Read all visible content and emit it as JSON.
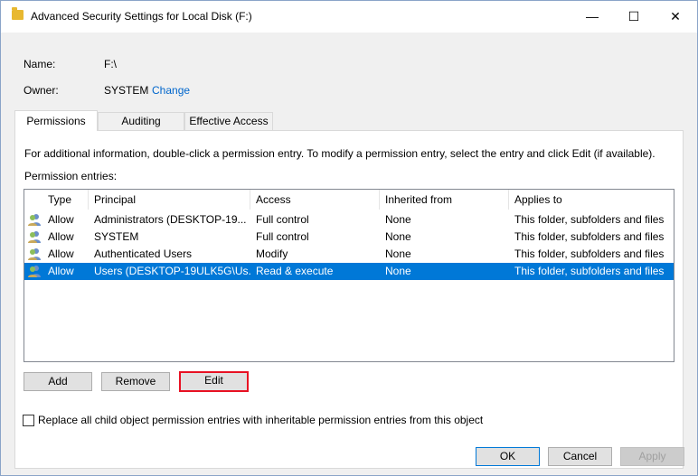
{
  "window": {
    "title": "Advanced Security Settings for Local Disk (F:)",
    "controls": {
      "minimize": "—",
      "maximize": "☐",
      "close": "✕"
    }
  },
  "info": {
    "name_label": "Name:",
    "name_value": "F:\\",
    "owner_label": "Owner:",
    "owner_value": "SYSTEM",
    "change_link": "Change"
  },
  "tabs": [
    {
      "label": "Permissions",
      "active": true
    },
    {
      "label": "Auditing",
      "active": false
    },
    {
      "label": "Effective Access",
      "active": false
    }
  ],
  "permissions": {
    "info_text": "For additional information, double-click a permission entry. To modify a permission entry, select the entry and click Edit (if available).",
    "entries_label": "Permission entries:",
    "columns": [
      "Type",
      "Principal",
      "Access",
      "Inherited from",
      "Applies to"
    ],
    "rows": [
      {
        "type": "Allow",
        "principal": "Administrators (DESKTOP-19...",
        "access": "Full control",
        "inherited": "None",
        "applies": "This folder, subfolders and files",
        "selected": false
      },
      {
        "type": "Allow",
        "principal": "SYSTEM",
        "access": "Full control",
        "inherited": "None",
        "applies": "This folder, subfolders and files",
        "selected": false
      },
      {
        "type": "Allow",
        "principal": "Authenticated Users",
        "access": "Modify",
        "inherited": "None",
        "applies": "This folder, subfolders and files",
        "selected": false
      },
      {
        "type": "Allow",
        "principal": "Users (DESKTOP-19ULK5G\\Us...",
        "access": "Read & execute",
        "inherited": "None",
        "applies": "This folder, subfolders and files",
        "selected": true
      }
    ],
    "add_label": "Add",
    "remove_label": "Remove",
    "edit_label": "Edit"
  },
  "replace_checkbox": {
    "label": "Replace all child object permission entries with inheritable permission entries from this object",
    "checked": false
  },
  "footer": {
    "ok_label": "OK",
    "cancel_label": "Cancel",
    "apply_label": "Apply"
  },
  "colors": {
    "selection": "#0078d7",
    "link": "#0066cc",
    "highlight_border": "#e81123"
  },
  "icons": {
    "title": "folder-icon",
    "row": "users-icon"
  }
}
